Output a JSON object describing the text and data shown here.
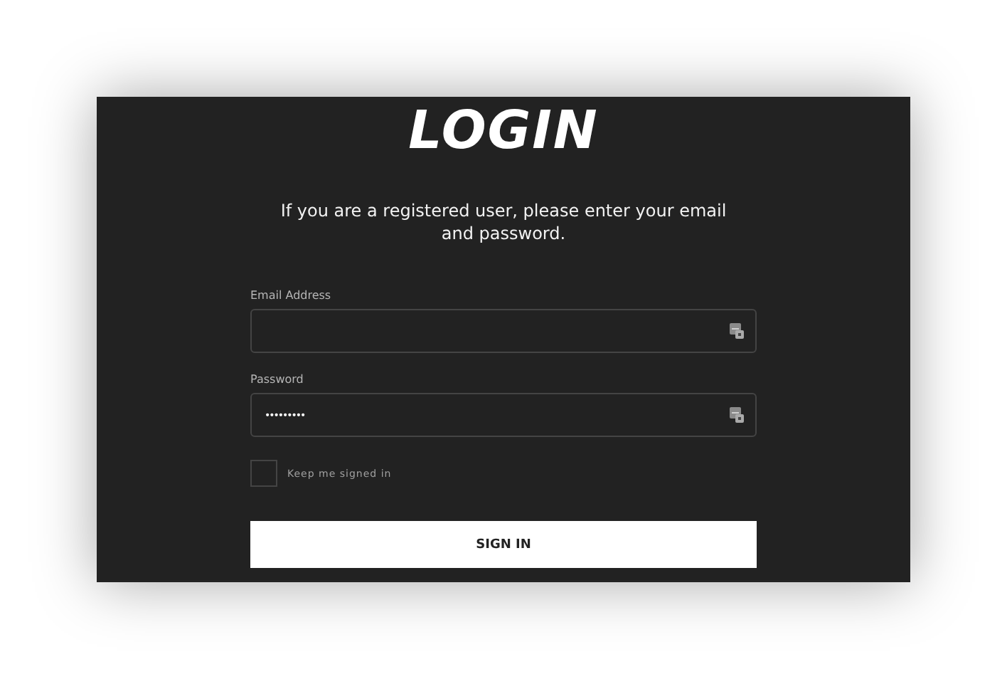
{
  "title": "LOGIN",
  "intro": "If you are a registered user, please enter your email and password.",
  "fields": [
    {
      "label": "Email Address"
    },
    {
      "label": "Password",
      "value": "•••••••••"
    }
  ],
  "remember": {
    "label": "Keep me signed in",
    "checked": false
  },
  "submit": "SIGN IN"
}
